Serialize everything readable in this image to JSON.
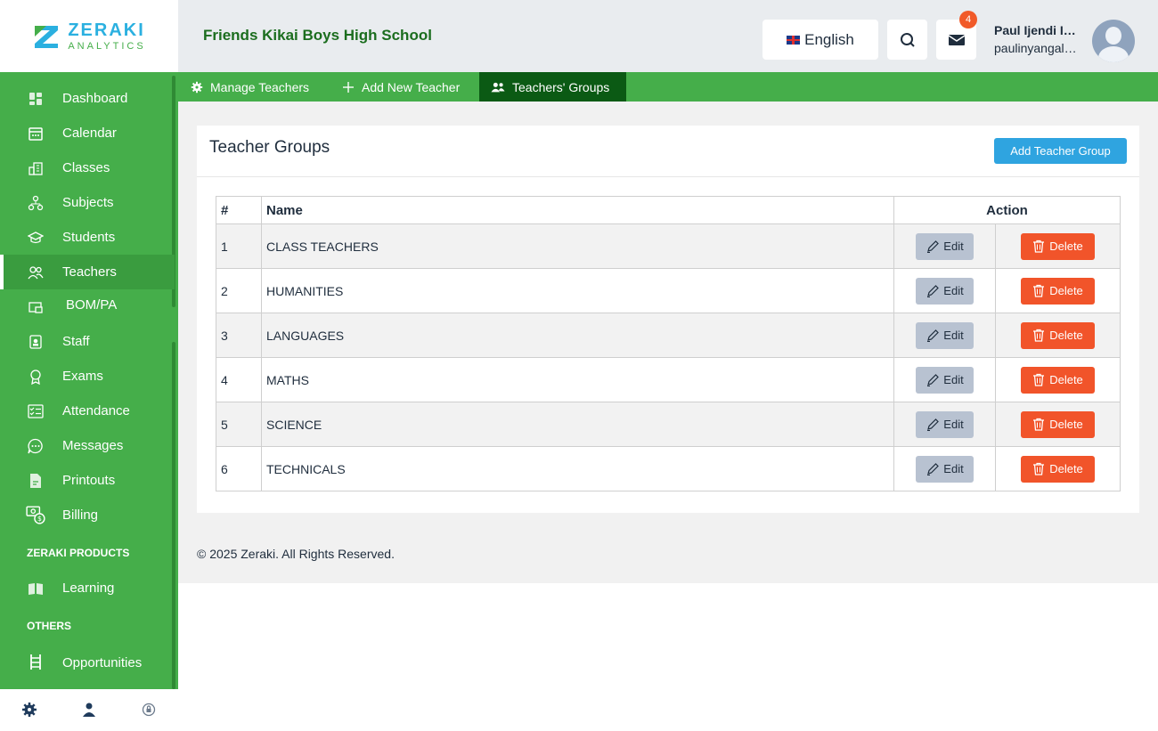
{
  "brand": {
    "name": "ZERAKI",
    "sub": "ANALYTICS"
  },
  "header": {
    "school": "Friends Kikai Boys High School",
    "language": "English",
    "notifications": "4",
    "user_name": "Paul Ijendi Inya…",
    "user_email": "paulinyangal…"
  },
  "sidebar": {
    "items": [
      {
        "label": "Dashboard",
        "icon": "dashboard-icon"
      },
      {
        "label": "Calendar",
        "icon": "calendar-icon"
      },
      {
        "label": "Classes",
        "icon": "classes-icon"
      },
      {
        "label": "Subjects",
        "icon": "subjects-icon"
      },
      {
        "label": "Students",
        "icon": "students-icon"
      },
      {
        "label": "Teachers",
        "icon": "teachers-icon"
      },
      {
        "label": "BOM/PA",
        "icon": "bom-icon"
      },
      {
        "label": "Staff",
        "icon": "staff-icon"
      },
      {
        "label": "Exams",
        "icon": "exams-icon"
      },
      {
        "label": "Attendance",
        "icon": "attendance-icon"
      },
      {
        "label": "Messages",
        "icon": "messages-icon"
      },
      {
        "label": "Printouts",
        "icon": "printouts-icon"
      },
      {
        "label": "Billing",
        "icon": "billing-icon"
      }
    ],
    "section_products": "ZERAKI PRODUCTS",
    "learning": "Learning",
    "section_others": "OTHERS",
    "opportunities": "Opportunities"
  },
  "tabs": [
    {
      "label": "Manage Teachers"
    },
    {
      "label": "Add New Teacher"
    },
    {
      "label": "Teachers' Groups"
    }
  ],
  "main": {
    "title": "Teacher Groups",
    "add_button": "Add Teacher Group",
    "columns": {
      "num": "#",
      "name": "Name",
      "action": "Action"
    },
    "edit_label": "Edit",
    "delete_label": "Delete",
    "rows": [
      {
        "num": "1",
        "name": "CLASS TEACHERS"
      },
      {
        "num": "2",
        "name": "HUMANITIES"
      },
      {
        "num": "3",
        "name": "LANGUAGES"
      },
      {
        "num": "4",
        "name": "MATHS"
      },
      {
        "num": "5",
        "name": "SCIENCE"
      },
      {
        "num": "6",
        "name": "TECHNICALS"
      }
    ]
  },
  "footer": {
    "text": "© 2025 Zeraki. All Rights Reserved."
  },
  "colors": {
    "brand_green": "#45ae4a",
    "dark_green": "#0b5a14",
    "blue": "#2fa4e0",
    "danger": "#f1542a"
  }
}
